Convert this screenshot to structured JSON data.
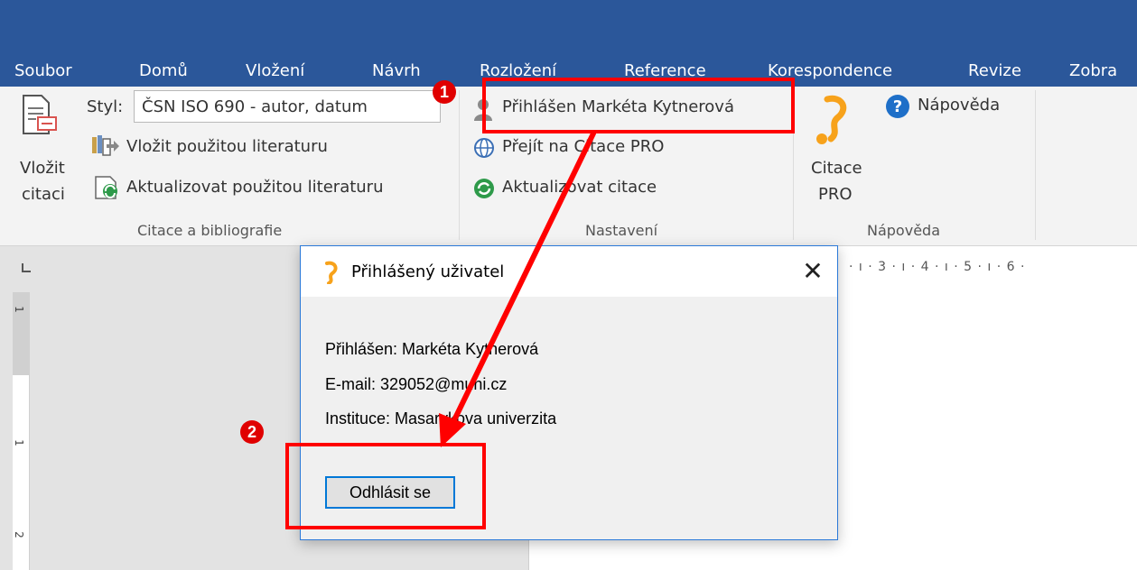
{
  "tabs": [
    "Soubor",
    "Domů",
    "Vložení",
    "Návrh",
    "Rozložení",
    "Reference",
    "Korespondence",
    "Revize",
    "Zobra"
  ],
  "ribbon": {
    "insert_citation_label": [
      "Vložit",
      "citaci"
    ],
    "style_label": "Styl:",
    "style_value": "ČSN ISO 690 - autor, datum",
    "insert_bibliography": "Vložit použitou literaturu",
    "update_bibliography": "Aktualizovat použitou literaturu",
    "group1_label": "Citace a bibliografie",
    "logged_in": "Přihlášen Markéta Kytnerová",
    "goto_citace": "Přejít na Citace PRO",
    "update_citations": "Aktualizovat citace",
    "group2_label": "Nastavení",
    "citace_pro_label": [
      "Citace",
      "PRO"
    ],
    "help": "Nápověda",
    "group3_label": "Nápověda"
  },
  "ruler": {
    "horizontal": "· ı · 3 · ı · 4 · ı · 5 · ı · 6 ·",
    "vertical": [
      "1",
      "1",
      "2"
    ]
  },
  "dialog": {
    "title": "Přihlášený uživatel",
    "close_glyph": "✕",
    "lines": [
      "Přihlášen: Markéta Kytnerová",
      "E-mail: 329052@muni.cz",
      "Instituce: Masarykova univerzita"
    ],
    "logout_button": "Odhlásit se"
  },
  "annotations": {
    "badge1": "1",
    "badge2": "2"
  },
  "colors": {
    "ribbon_blue": "#2b579a",
    "annotation_red": "#ff0000",
    "citace_orange": "#f7a21b",
    "help_blue": "#1e6fc8"
  }
}
